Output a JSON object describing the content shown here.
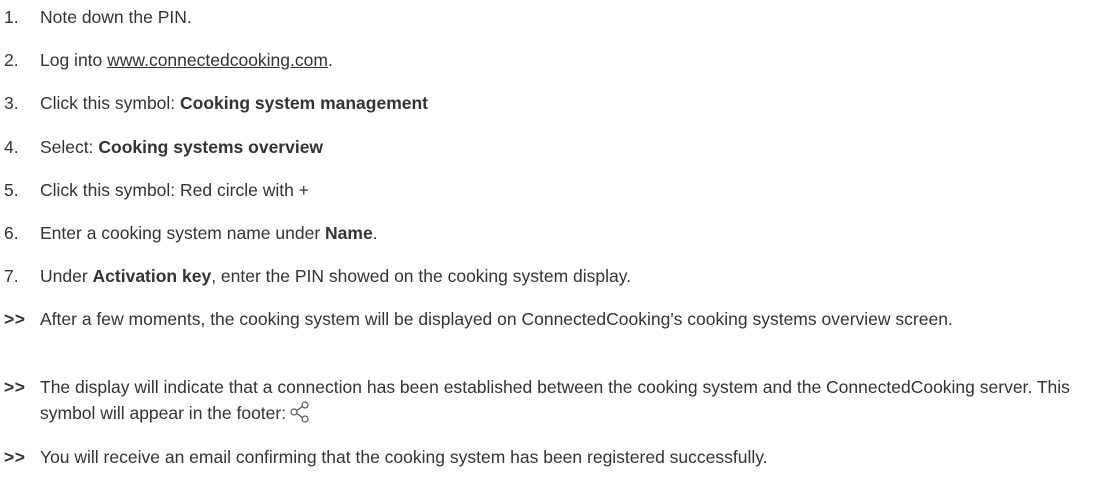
{
  "steps": [
    {
      "marker": "1.",
      "before": "Note down the PIN."
    },
    {
      "marker": "2.",
      "before": "Log into ",
      "link": "www.connectedcooking.com",
      "after": "."
    },
    {
      "marker": "3.",
      "before": "Click this symbol: ",
      "bold": "Cooking system management"
    },
    {
      "marker": "4.",
      "before": "Select: ",
      "bold": "Cooking systems overview"
    },
    {
      "marker": "5.",
      "before": "Click this symbol: Red circle with +"
    },
    {
      "marker": "6.",
      "before": "Enter a cooking system name under ",
      "bold": "Name",
      "after": "."
    },
    {
      "marker": "7.",
      "before": "Under ",
      "bold": "Activation key",
      "after": ", enter the PIN showed on the cooking system display."
    }
  ],
  "results": [
    {
      "marker": ">>",
      "text": "After a few moments, the cooking system will be displayed on ConnectedCooking's cooking systems overview screen."
    },
    {
      "marker": ">>",
      "text": "The display will indicate that a connection has been established between the cooking system and the ConnectedCooking server. This symbol will appear in the footer:",
      "icon": "share-icon"
    },
    {
      "marker": ">>",
      "text": "You will receive an email confirming that the cooking system has been registered successfully."
    }
  ]
}
